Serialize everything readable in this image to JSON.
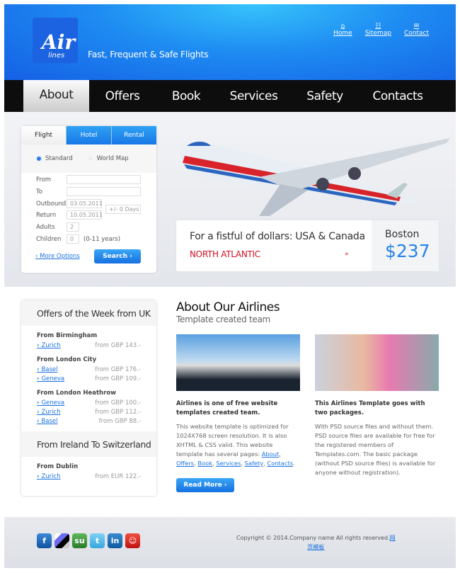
{
  "header": {
    "logo_text": "Air",
    "logo_sub": "lines",
    "tagline": "Fast, Frequent & Safe Flights",
    "links": [
      {
        "label": "Home",
        "icon": "home-icon"
      },
      {
        "label": "Sitemap",
        "icon": "sitemap-icon"
      },
      {
        "label": "Contact",
        "icon": "mail-icon"
      }
    ]
  },
  "nav": [
    {
      "label": "About",
      "active": true
    },
    {
      "label": "Offers"
    },
    {
      "label": "Book"
    },
    {
      "label": "Services"
    },
    {
      "label": "Safety"
    },
    {
      "label": "Contacts"
    }
  ],
  "search": {
    "tabs": [
      "Flight",
      "Hotel",
      "Rental"
    ],
    "radios": [
      "Standard",
      "World Map"
    ],
    "from_label": "From",
    "to_label": "To",
    "outbound_label": "Outbound",
    "outbound_value": "03.05.2011",
    "return_label": "Return",
    "return_value": "10.05.2011",
    "flex_value": "+/- 0 Days",
    "adults_label": "Adults",
    "adults_value": "2",
    "children_label": "Children",
    "children_value": "0",
    "children_note": "(0-11 years)",
    "more_options": "More Options",
    "search_button": "Search"
  },
  "promo": {
    "title": "For a fistful of dollars: USA & Canada",
    "subtitle": "NORTH ATLANTIC",
    "city": "Boston",
    "price": "$237"
  },
  "offers": {
    "title": "Offers of the Week from UK",
    "groups": [
      {
        "from": "From Birmingham",
        "items": [
          {
            "dest": "Zurich",
            "price": "from GBP 143.-"
          }
        ]
      },
      {
        "from": "From London City",
        "items": [
          {
            "dest": "Basel",
            "price": "from GBP 176.-"
          },
          {
            "dest": "Geneva",
            "price": "from GBP 109.-"
          }
        ]
      },
      {
        "from": "From London Heathrow",
        "items": [
          {
            "dest": "Geneva",
            "price": "from GBP 100.-"
          },
          {
            "dest": "Zurich",
            "price": "from GBP 112.-"
          },
          {
            "dest": "Basel",
            "price": "from GBP 88.-"
          }
        ]
      }
    ],
    "title2": "From Ireland To Switzerland",
    "group2": {
      "from": "From Dublin",
      "items": [
        {
          "dest": "Zurich",
          "price": "from EUR 122.-"
        }
      ]
    }
  },
  "about": {
    "title": "About Our Airlines",
    "subtitle": "Template created team",
    "col1_heading": "Airlines is one of free website templates created team.",
    "col1_text": "This website template is optimized for 1024X768 screen resolution. It is also XHTML & CSS valid. This website template has several pages: ",
    "col1_links": [
      "About",
      "Offers",
      "Book",
      "Services",
      "Safety",
      "Contacts"
    ],
    "read_more": "Read More",
    "col2_heading": "This Airlines Template goes with two packages.",
    "col2_text": "With PSD source files and without them. PSD source files are available for free for the registered members of Templates.com. The basic package (without PSD source files) is available for anyone without registration)."
  },
  "footer": {
    "social": [
      "facebook",
      "delicious",
      "stumbleupon",
      "twitter",
      "linkedin",
      "reddit"
    ],
    "copyright": "Copyright © 2014.Company name All rights reserved.",
    "link1": "网",
    "link2": "页模板"
  },
  "colors": {
    "accent": "#1e8cf2",
    "nav": "#0d0d0d",
    "promo_red": "#cf1020",
    "price_blue": "#2684e8"
  }
}
